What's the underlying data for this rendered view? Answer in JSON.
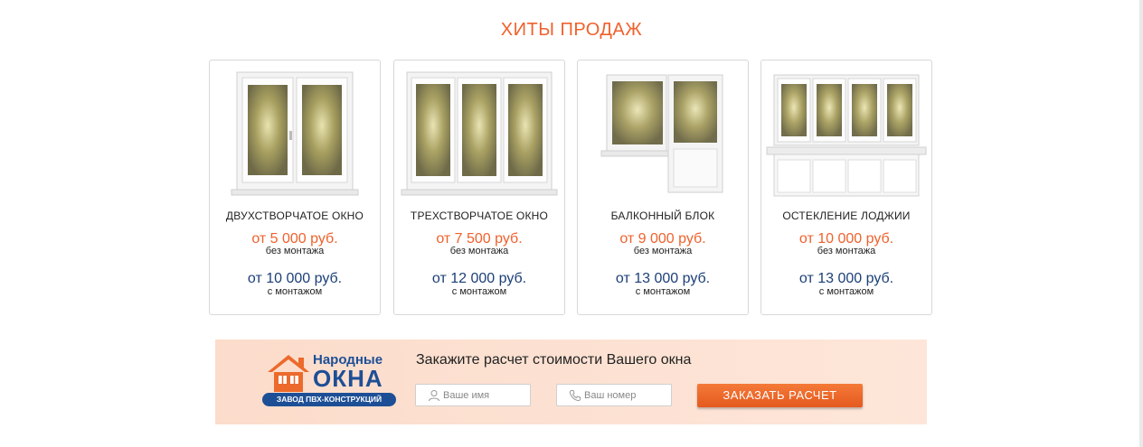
{
  "section_title": "ХИТЫ ПРОДАЖ",
  "products": [
    {
      "name": "ДВУХСТВОРЧАТОЕ ОКНО",
      "price_no_install": "от 5 000 руб.",
      "note_no_install": "без монтажа",
      "price_install": "от 10 000 руб.",
      "note_install": "с монтажом",
      "image_icon": "two-sash-window-image"
    },
    {
      "name": "ТРЕХСТВОРЧАТОЕ ОКНО",
      "price_no_install": "от 7 500 руб.",
      "note_no_install": "без монтажа",
      "price_install": "от 12 000 руб.",
      "note_install": "с монтажом",
      "image_icon": "three-sash-window-image"
    },
    {
      "name": "БАЛКОННЫЙ БЛОК",
      "price_no_install": "от 9 000 руб.",
      "note_no_install": "без монтажа",
      "price_install": "от 13 000 руб.",
      "note_install": "с монтажом",
      "image_icon": "balcony-block-image"
    },
    {
      "name": "ОСТЕКЛЕНИЕ ЛОДЖИИ",
      "price_no_install": "от 10 000 руб.",
      "note_no_install": "без монтажа",
      "price_install": "от 13 000 руб.",
      "note_install": "с монтажом",
      "image_icon": "loggia-glazing-image"
    }
  ],
  "banner": {
    "logo_top": "Народные",
    "logo_big": "ОКНА",
    "logo_strip": "ЗАВОД ПВХ-КОНСТРУКЦИЙ",
    "title": "Закажите расчет стоимости Вашего окна",
    "name_placeholder": "Ваше имя",
    "phone_placeholder": "Ваш номер",
    "button_label": "ЗАКАЗАТЬ РАСЧЕТ"
  },
  "colors": {
    "accent": "#f0612c",
    "brand_blue": "#1c3f77",
    "banner_bg": "#fde2d3"
  }
}
